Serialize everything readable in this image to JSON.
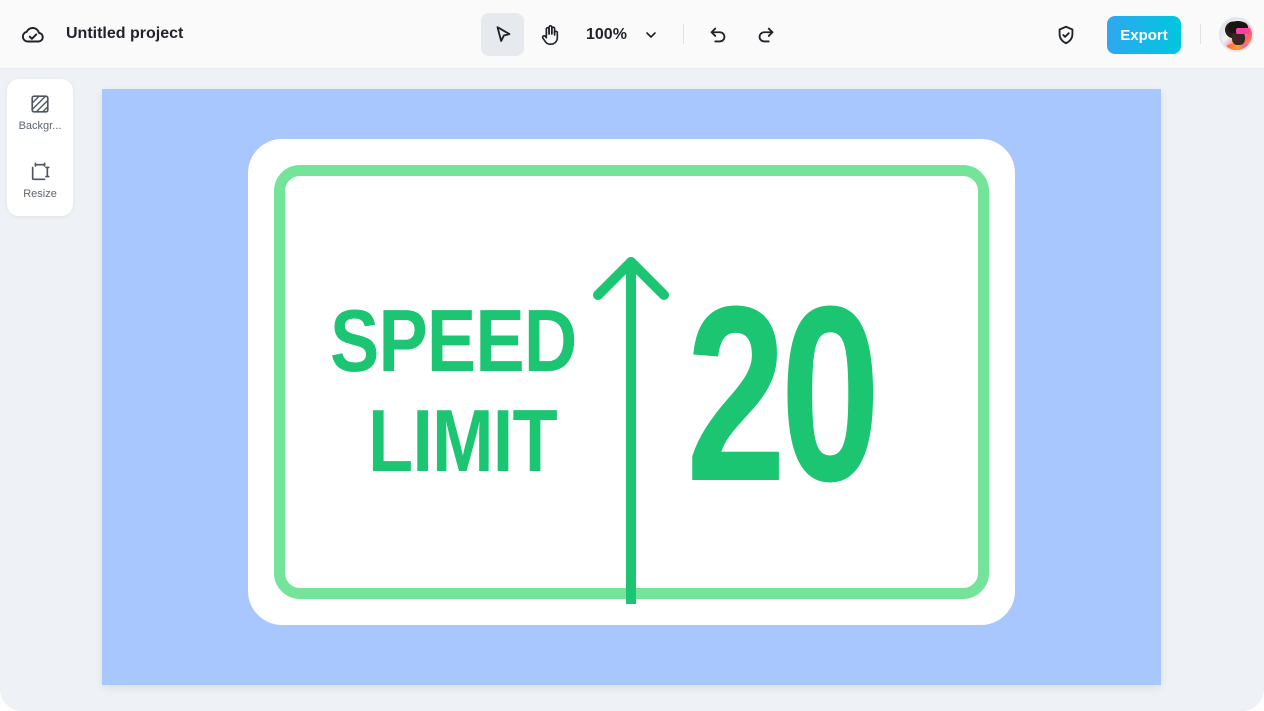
{
  "app": {
    "project_title": "Untitled project",
    "logo_icon": "cloud-check-icon"
  },
  "toolbar": {
    "select_tool_icon": "pointer-icon",
    "hand_tool_icon": "hand-icon",
    "zoom_level": "100%",
    "zoom_dropdown_icon": "chevron-down-icon",
    "undo_icon": "undo-icon",
    "redo_icon": "redo-icon",
    "shield_icon": "shield-check-icon",
    "export_label": "Export",
    "active_tool": "select"
  },
  "side_panel": {
    "items": [
      {
        "label": "Backgr...",
        "icon": "background-icon"
      },
      {
        "label": "Resize",
        "icon": "resize-icon"
      }
    ]
  },
  "canvas": {
    "background_color": "#a8c7fe",
    "sign": {
      "line1": "SPEED",
      "line2": "LIMIT",
      "number": "20",
      "text_color": "#1bc572",
      "border_color": "#74e49a",
      "arrow_icon": "arrow-up-icon"
    }
  },
  "colors": {
    "export_gradient_start": "#2fa8ef",
    "export_gradient_end": "#00c6e0"
  }
}
